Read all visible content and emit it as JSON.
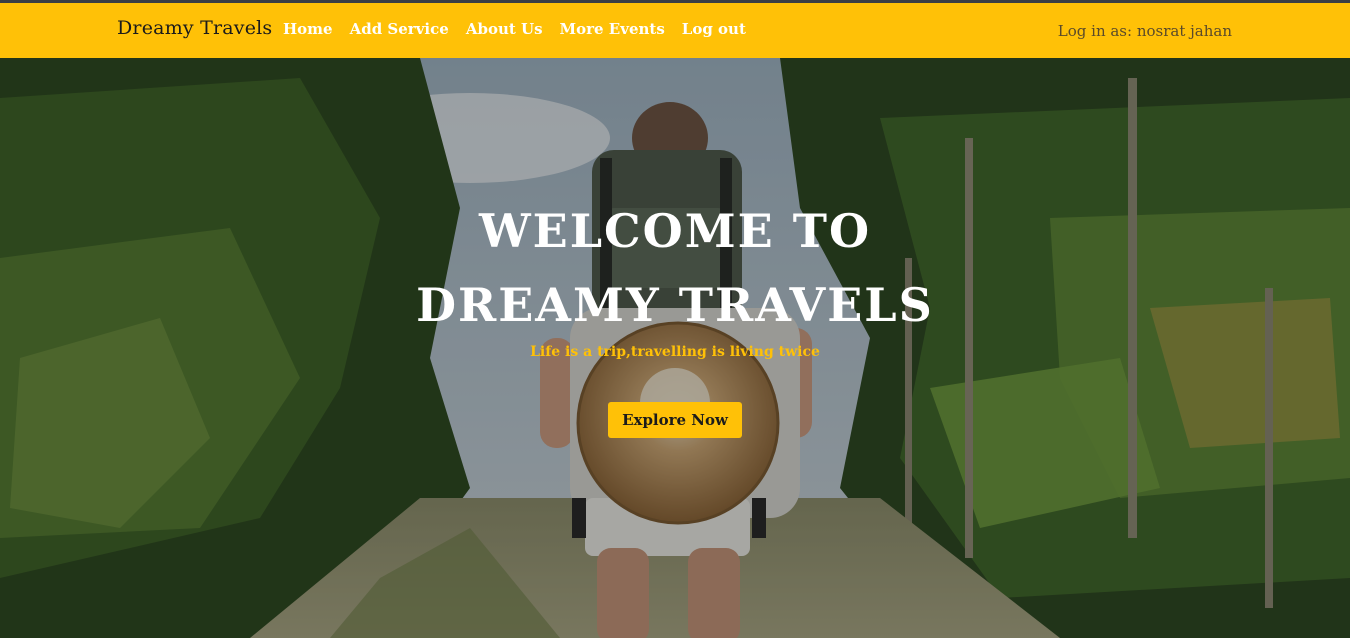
{
  "navbar": {
    "brand": "Dreamy Travels",
    "links": [
      {
        "label": "Home"
      },
      {
        "label": "Add Service"
      },
      {
        "label": "About Us"
      },
      {
        "label": "More Events"
      },
      {
        "label": "Log out"
      }
    ],
    "login_status": "Log in as: nosrat jahan"
  },
  "hero": {
    "title": "WELCOME TO DREAMY TRAVELS",
    "tagline": "Life is a trip,travelling is living twice",
    "cta_label": "Explore Now"
  },
  "colors": {
    "accent": "#ffc107",
    "nav_link": "#ffffff",
    "brand_text": "#1b1b1b"
  }
}
